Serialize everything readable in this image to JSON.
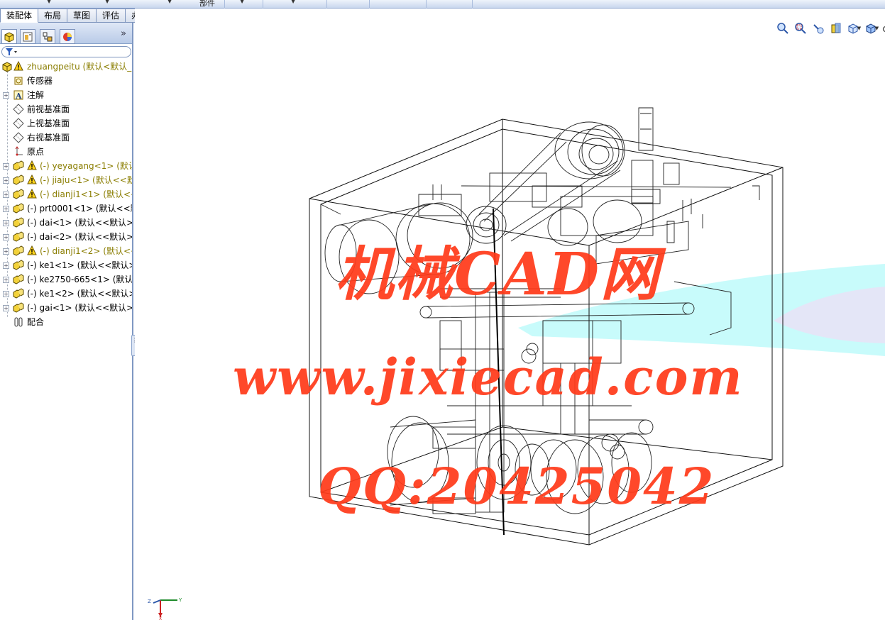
{
  "top_strip": {
    "part_label": "部件"
  },
  "tabs": [
    {
      "label": "装配体",
      "active": true
    },
    {
      "label": "布局",
      "active": false
    },
    {
      "label": "草图",
      "active": false
    },
    {
      "label": "评估",
      "active": false
    },
    {
      "label": "办公室产品",
      "active": false
    }
  ],
  "panel": {
    "collapse_glyph": "»"
  },
  "tree": {
    "root": "zhuangpeitu  (默认<默认_",
    "items": [
      {
        "label": "传感器",
        "icon": "sensor-icon",
        "expandable": false,
        "warn": false,
        "color": "normal"
      },
      {
        "label": "注解",
        "icon": "annotation-icon",
        "expandable": true,
        "warn": false,
        "color": "normal"
      },
      {
        "label": "前视基准面",
        "icon": "plane-icon",
        "expandable": false,
        "warn": false,
        "color": "normal"
      },
      {
        "label": "上视基准面",
        "icon": "plane-icon",
        "expandable": false,
        "warn": false,
        "color": "normal"
      },
      {
        "label": "右视基准面",
        "icon": "plane-icon",
        "expandable": false,
        "warn": false,
        "color": "normal"
      },
      {
        "label": "原点",
        "icon": "origin-icon",
        "expandable": false,
        "warn": false,
        "color": "normal"
      },
      {
        "label": "(-) yeyagang<1> (默认",
        "icon": "part-icon",
        "expandable": true,
        "warn": true,
        "color": "olive"
      },
      {
        "label": "(-) jiaju<1> (默认<<默",
        "icon": "part-icon",
        "expandable": true,
        "warn": true,
        "color": "olive"
      },
      {
        "label": "(-) dianji1<1> (默认<<",
        "icon": "part-icon",
        "expandable": true,
        "warn": true,
        "color": "olive"
      },
      {
        "label": "(-) prt0001<1> (默认<<默",
        "icon": "part-icon",
        "expandable": true,
        "warn": false,
        "color": "normal"
      },
      {
        "label": "(-) dai<1> (默认<<默认>_",
        "icon": "part-icon",
        "expandable": true,
        "warn": false,
        "color": "normal"
      },
      {
        "label": "(-) dai<2> (默认<<默认>_",
        "icon": "part-icon",
        "expandable": true,
        "warn": false,
        "color": "normal"
      },
      {
        "label": "(-) dianji1<2> (默认<<",
        "icon": "part-icon",
        "expandable": true,
        "warn": true,
        "color": "olive"
      },
      {
        "label": "(-) ke1<1> (默认<<默认>",
        "icon": "part-icon",
        "expandable": true,
        "warn": false,
        "color": "normal"
      },
      {
        "label": "(-) ke2750-665<1> (默认",
        "icon": "part-icon",
        "expandable": true,
        "warn": false,
        "color": "normal"
      },
      {
        "label": "(-) ke1<2> (默认<<默认>",
        "icon": "part-icon",
        "expandable": true,
        "warn": false,
        "color": "normal"
      },
      {
        "label": "(-) gai<1> (默认<<默认>_",
        "icon": "part-icon",
        "expandable": true,
        "warn": false,
        "color": "normal"
      },
      {
        "label": "配合",
        "icon": "mates-icon",
        "expandable": false,
        "warn": false,
        "color": "normal"
      }
    ]
  },
  "watermark": {
    "title": "机械CAD网",
    "url": "www.jixiecad.com",
    "qq": "QQ:20425042"
  },
  "triad": {
    "x": "X",
    "y": "Y",
    "z": "Z"
  },
  "colors": {
    "accent": "#7f98c3",
    "watermark": "#ff3b1a",
    "olive": "#8a7d00",
    "cyan": "#c8fbfb"
  }
}
